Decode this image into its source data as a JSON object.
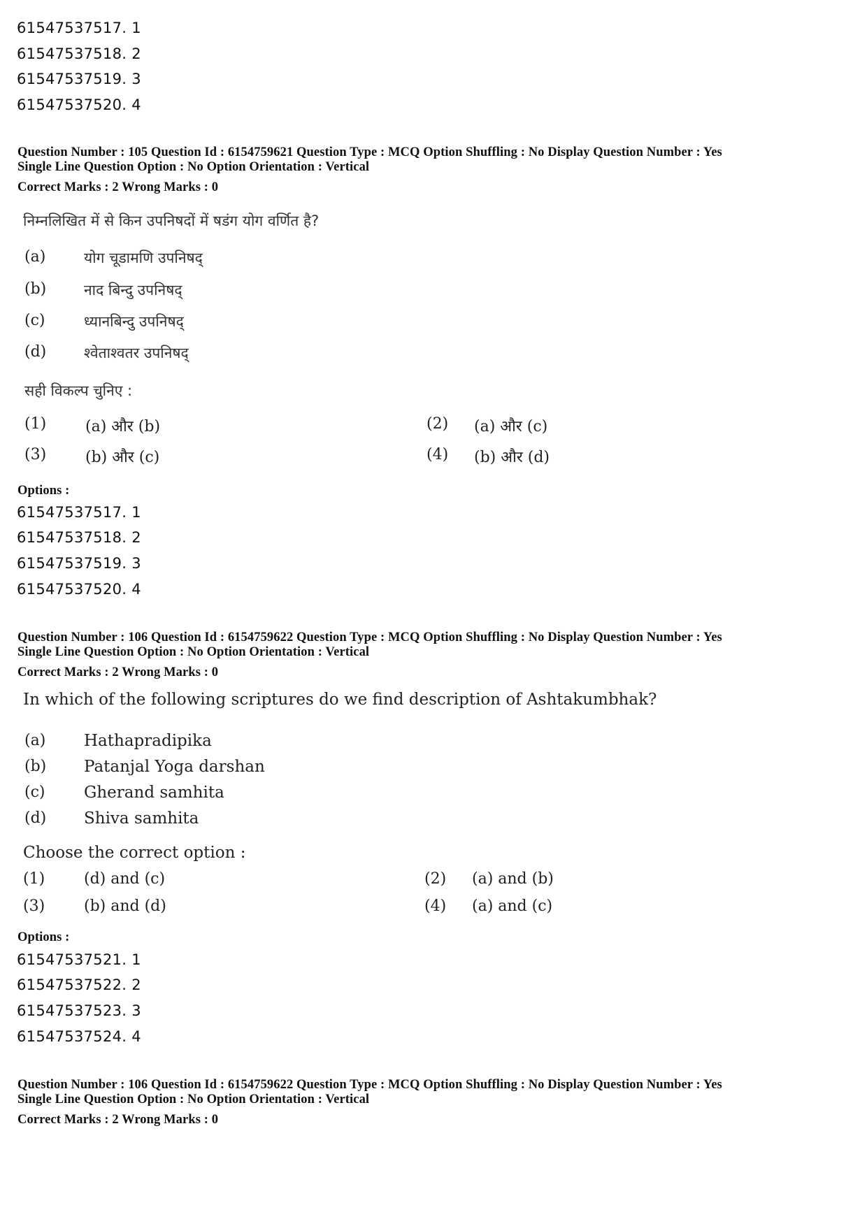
{
  "top_options": [
    "61547537517. 1",
    "61547537518. 2",
    "61547537519. 3",
    "61547537520. 4"
  ],
  "q105": {
    "header_line1": "Question Number : 105  Question Id : 6154759621  Question Type : MCQ  Option Shuffling : No  Display Question Number : Yes",
    "header_line2": "Single Line Question Option : No  Option Orientation : Vertical",
    "marks": "Correct Marks : 2  Wrong Marks : 0",
    "question": "निम्नलिखित में से किन उपनिषदों में षडंग योग वर्णित है?",
    "items": [
      {
        "label": "(a)",
        "text": "योग चूडामणि उपनिषद्"
      },
      {
        "label": "(b)",
        "text": "नाद बिन्दु उपनिषद्"
      },
      {
        "label": "(c)",
        "text": "ध्यानबिन्दु उपनिषद्"
      },
      {
        "label": "(d)",
        "text": "श्वेताश्वतर उपनिषद्"
      }
    ],
    "prompt": "सही विकल्प चुनिए :",
    "choices": [
      {
        "num": "(1)",
        "text": "(a) और (b)"
      },
      {
        "num": "(2)",
        "text": "(a) और (c)"
      },
      {
        "num": "(3)",
        "text": "(b) और (c)"
      },
      {
        "num": "(4)",
        "text": "(b) और (d)"
      }
    ],
    "options_label": "Options :",
    "options": [
      "61547537517. 1",
      "61547537518. 2",
      "61547537519. 3",
      "61547537520. 4"
    ]
  },
  "q106": {
    "header_line1": "Question Number : 106  Question Id : 6154759622  Question Type : MCQ  Option Shuffling : No  Display Question Number : Yes",
    "header_line2": "Single Line Question Option : No  Option Orientation : Vertical",
    "marks": "Correct Marks : 2  Wrong Marks : 0",
    "question": "In which of the following scriptures do we find description of Ashtakumbhak?",
    "items": [
      {
        "label": "(a)",
        "text": "Hathapradipika"
      },
      {
        "label": "(b)",
        "text": "Patanjal Yoga darshan"
      },
      {
        "label": "(c)",
        "text": "Gherand samhita"
      },
      {
        "label": "(d)",
        "text": "Shiva samhita"
      }
    ],
    "prompt": "Choose the correct option :",
    "choices": [
      {
        "num": "(1)",
        "text": "(d) and (c)"
      },
      {
        "num": "(2)",
        "text": "(a) and (b)"
      },
      {
        "num": "(3)",
        "text": "(b) and (d)"
      },
      {
        "num": "(4)",
        "text": "(a) and (c)"
      }
    ],
    "options_label": "Options :",
    "options": [
      "61547537521. 1",
      "61547537522. 2",
      "61547537523. 3",
      "61547537524. 4"
    ]
  },
  "q106_repeat": {
    "header_line1": "Question Number : 106  Question Id : 6154759622  Question Type : MCQ  Option Shuffling : No  Display Question Number : Yes",
    "header_line2": "Single Line Question Option : No  Option Orientation : Vertical",
    "marks": "Correct Marks : 2  Wrong Marks : 0"
  }
}
